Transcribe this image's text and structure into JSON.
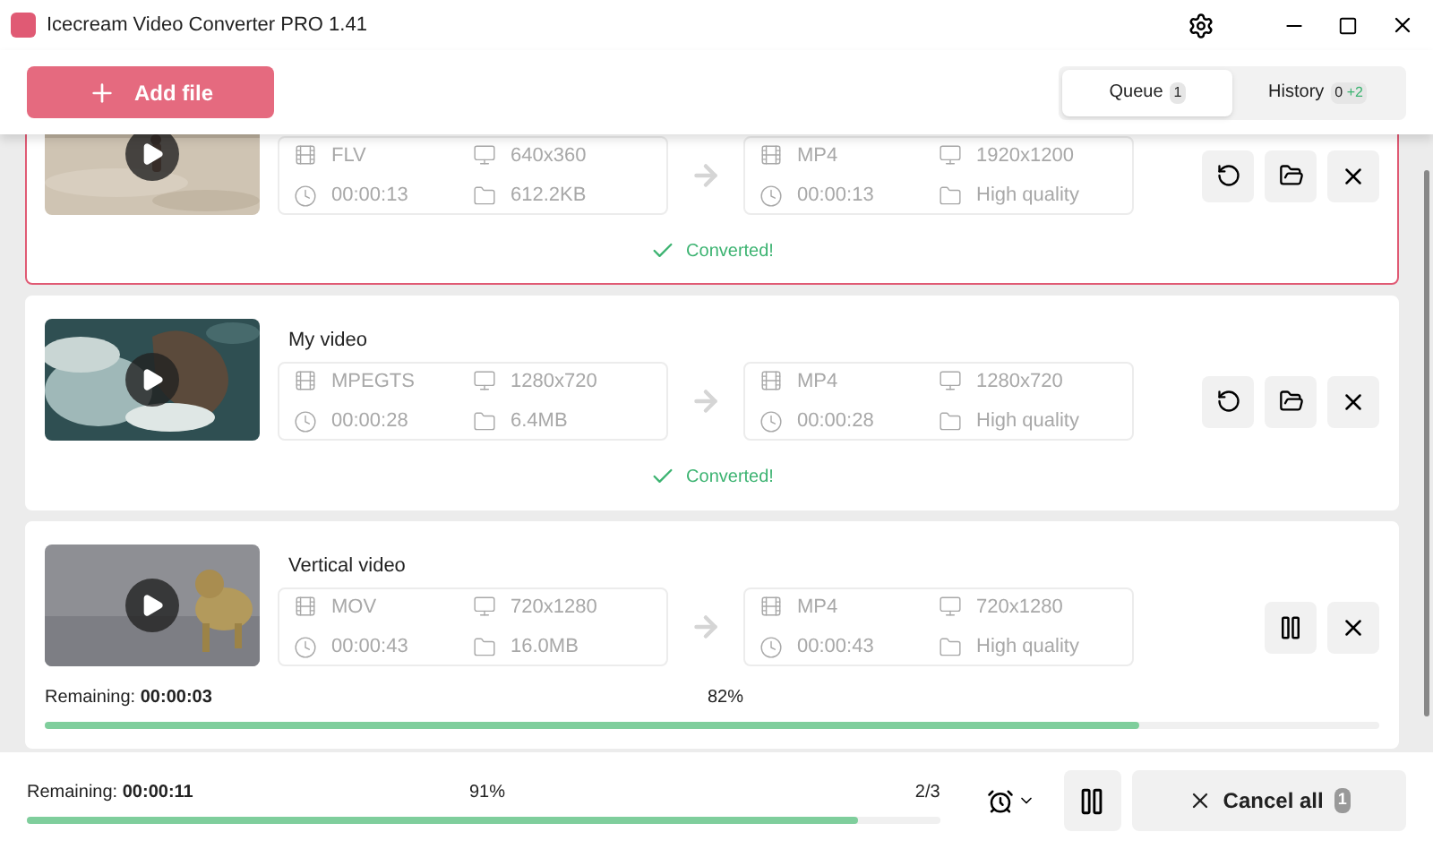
{
  "window": {
    "title": "Icecream Video Converter PRO 1.41"
  },
  "toolbar": {
    "add_button": "Add file",
    "tabs": [
      {
        "label": "Queue",
        "count": "1",
        "selected": true
      },
      {
        "label": "History",
        "count": "0",
        "extra": "+2",
        "selected": false
      }
    ]
  },
  "items": [
    {
      "selected": true,
      "kind": "converted",
      "source": {
        "format": "FLV",
        "resolution": "640x360",
        "duration": "00:00:13",
        "size": "612.2KB"
      },
      "output": {
        "format": "MP4",
        "resolution": "1920x1200",
        "duration": "00:00:13",
        "quality": "High quality"
      },
      "message": "Converted!"
    },
    {
      "selected": false,
      "title": "My video",
      "kind": "converted",
      "source": {
        "format": "MPEGTS",
        "resolution": "1280x720",
        "duration": "00:00:28",
        "size": "6.4MB"
      },
      "output": {
        "format": "MP4",
        "resolution": "1280x720",
        "duration": "00:00:28",
        "quality": "High quality"
      },
      "message": "Converted!"
    },
    {
      "selected": false,
      "title": "Vertical video",
      "kind": "converting",
      "source": {
        "format": "MOV",
        "resolution": "720x1280",
        "duration": "00:00:43",
        "size": "16.0MB"
      },
      "output": {
        "format": "MP4",
        "resolution": "720x1280",
        "duration": "00:00:43",
        "quality": "High quality"
      },
      "remaining_label": "Remaining:",
      "remaining": "00:00:03",
      "percent": "82%",
      "level": 0.82
    }
  ],
  "footer": {
    "remaining_label": "Remaining:",
    "remaining": "00:00:11",
    "percent": "91%",
    "level": 0.91,
    "count": "2/3",
    "cancel_button": "Cancel all",
    "cancel_count": "1"
  }
}
